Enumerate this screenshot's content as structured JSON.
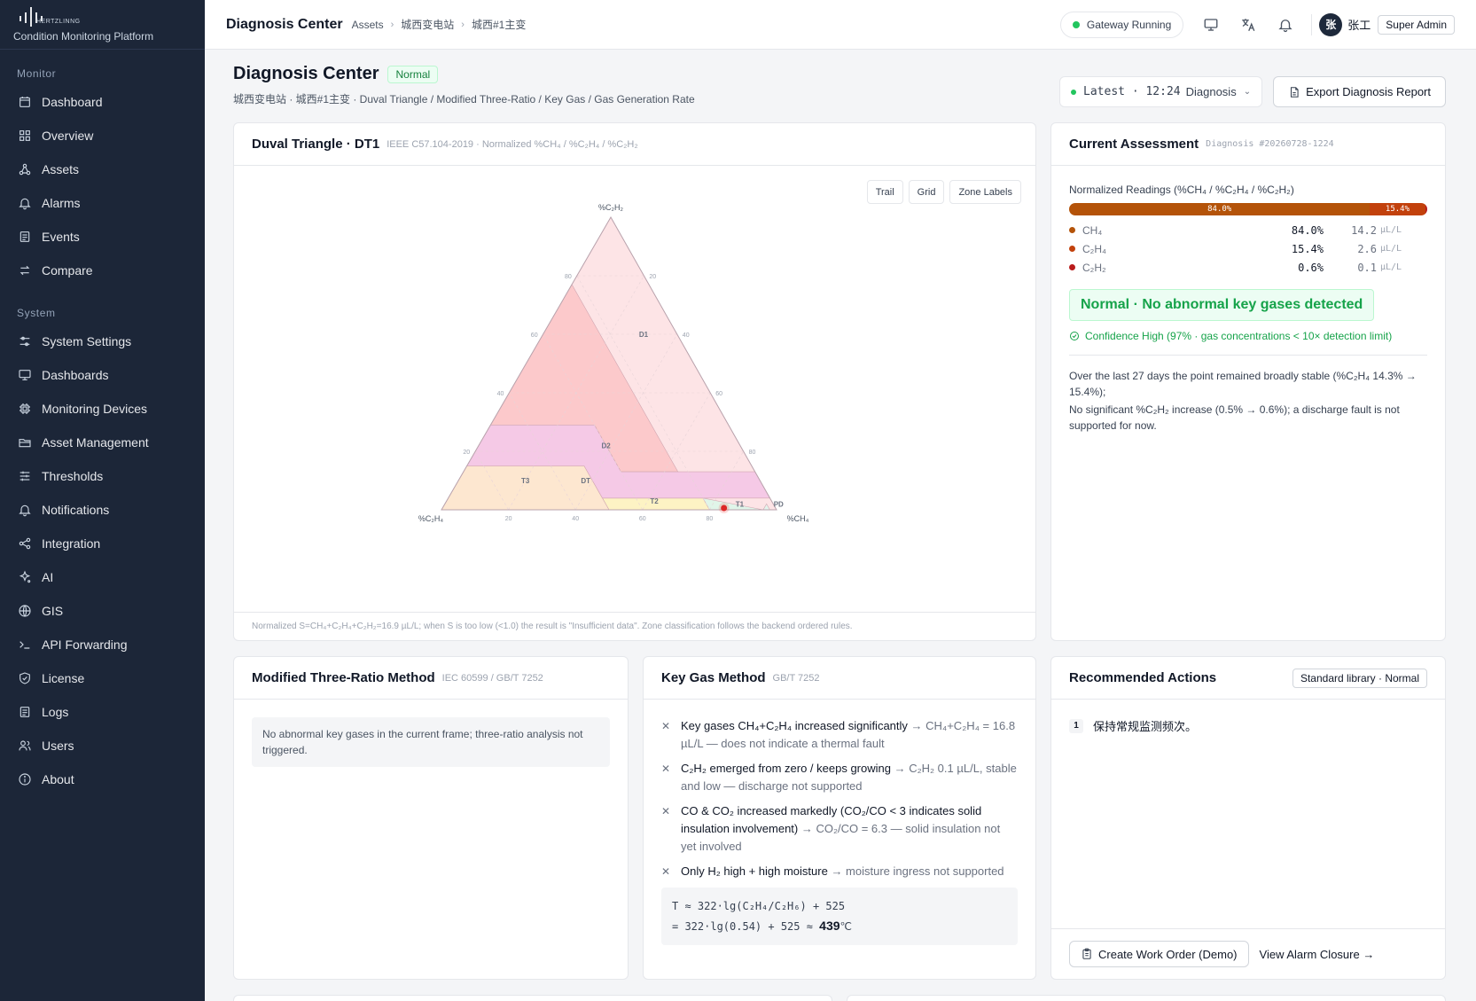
{
  "brand": {
    "logo_text": "HERTZLINNG",
    "subtitle": "Condition Monitoring Platform"
  },
  "sidebar": {
    "sections": [
      {
        "label": "Monitor",
        "items": [
          {
            "label": "Dashboard",
            "icon": "calendar-icon"
          },
          {
            "label": "Overview",
            "icon": "grid-icon"
          },
          {
            "label": "Assets",
            "icon": "nodes-icon"
          },
          {
            "label": "Alarms",
            "icon": "bell-icon"
          },
          {
            "label": "Events",
            "icon": "list-icon"
          },
          {
            "label": "Compare",
            "icon": "swap-icon"
          }
        ]
      },
      {
        "label": "System",
        "items": [
          {
            "label": "System Settings",
            "icon": "sliders-icon"
          },
          {
            "label": "Dashboards",
            "icon": "monitor-icon"
          },
          {
            "label": "Monitoring Devices",
            "icon": "chip-icon"
          },
          {
            "label": "Asset Management",
            "icon": "folder-icon"
          },
          {
            "label": "Thresholds",
            "icon": "tune-icon"
          },
          {
            "label": "Notifications",
            "icon": "bell-icon"
          },
          {
            "label": "Integration",
            "icon": "link-icon"
          },
          {
            "label": "AI",
            "icon": "sparkle-icon"
          },
          {
            "label": "GIS",
            "icon": "globe-icon"
          },
          {
            "label": "API Forwarding",
            "icon": "terminal-icon"
          },
          {
            "label": "License",
            "icon": "shield-icon"
          },
          {
            "label": "Logs",
            "icon": "list-icon"
          },
          {
            "label": "Users",
            "icon": "users-icon"
          },
          {
            "label": "About",
            "icon": "info-icon"
          }
        ]
      }
    ]
  },
  "topbar": {
    "title": "Diagnosis Center",
    "breadcrumb": [
      "Assets",
      "城西变电站",
      "城西#1主变"
    ],
    "gateway_status": "Gateway Running",
    "avatar_initial": "张",
    "username": "张工",
    "role": "Super Admin"
  },
  "page": {
    "title": "Diagnosis Center",
    "status_badge": "Normal",
    "subtitle": "城西变电站 · 城西#1主变 · Duval Triangle / Modified Three-Ratio / Key Gas / Gas Generation Rate",
    "select_time": "Latest · 12:24",
    "select_label": "Diagnosis",
    "export_label": "Export Diagnosis Report"
  },
  "duval": {
    "title": "Duval Triangle · DT1",
    "meta": "IEEE C57.104-2019 · Normalized %CH₄ / %C₂H₄ / %C₂H₂",
    "toolbar": [
      "Trail",
      "Grid",
      "Zone Labels"
    ],
    "vertex_labels": {
      "top": "%C₂H₂",
      "left": "%C₂H₄",
      "right": "%CH₄"
    },
    "zones": [
      "D1",
      "D2",
      "DT",
      "T3",
      "T2",
      "T1",
      "PD"
    ],
    "footer": "Normalized S=CH₄+C₂H₄+C₂H₂=16.9 µL/L; when S is too low (<1.0) the result is \"Insufficient data\". Zone classification follows the backend ordered rules."
  },
  "chart_data": {
    "type": "scatter",
    "title": "Duval Triangle · DT1",
    "axes": [
      "%CH₄",
      "%C₂H₄",
      "%C₂H₂"
    ],
    "ticks": [
      20,
      40,
      60,
      80
    ],
    "points": [
      {
        "ch4": 84.0,
        "c2h4": 15.4,
        "c2h2": 0.6
      }
    ],
    "zones": [
      "D1",
      "D2",
      "DT",
      "T3",
      "T2",
      "T1",
      "PD"
    ]
  },
  "assessment": {
    "title": "Current Assessment",
    "meta": "Diagnosis #20260728-1224",
    "readings_label": "Normalized Readings (%CH₄ / %C₂H₄ / %C₂H₂)",
    "bar": [
      {
        "label": "84.0%",
        "fraction": 0.84,
        "color": "#b45309"
      },
      {
        "label": "15.4%",
        "fraction": 0.154,
        "color": "#c2410c"
      },
      {
        "label": "",
        "fraction": 0.006,
        "color": "#b91c1c"
      }
    ],
    "gases": [
      {
        "name": "CH₄",
        "pct": "84.0%",
        "value": "14.2",
        "unit": "µL/L",
        "color": "#b45309"
      },
      {
        "name": "C₂H₄",
        "pct": "15.4%",
        "value": "2.6",
        "unit": "µL/L",
        "color": "#c2410c"
      },
      {
        "name": "C₂H₂",
        "pct": "0.6%",
        "value": "0.1",
        "unit": "µL/L",
        "color": "#b91c1c"
      }
    ],
    "result": "Normal · No abnormal key gases detected",
    "confidence": "Confidence High (97% · gas concentrations < 10× detection limit)",
    "narrative": [
      "Over the last 27 days the point remained broadly stable (%C₂H₄ 14.3% → 15.4%);",
      "No significant %C₂H₂ increase (0.5% → 0.6%); a discharge fault is not supported for now."
    ]
  },
  "ratio": {
    "title": "Modified Three-Ratio Method",
    "meta": "IEC 60599 / GB/T 7252",
    "note": "No abnormal key gases in the current frame; three-ratio analysis not triggered."
  },
  "keygas": {
    "title": "Key Gas Method",
    "meta": "GB/T 7252",
    "items": [
      {
        "cond": "Key gases CH₄+C₂H₄ increased significantly",
        "res": " → CH₄+C₂H₄ = 16.8 µL/L — does not indicate a thermal fault"
      },
      {
        "cond": "C₂H₂ emerged from zero / keeps growing",
        "res": " → C₂H₂ 0.1 µL/L, stable and low — discharge not supported"
      },
      {
        "cond": "CO & CO₂ increased markedly (CO₂/CO < 3 indicates solid insulation involvement)",
        "res": " → CO₂/CO = 6.3 — solid insulation not yet involved"
      },
      {
        "cond": "Only H₂ high + high moisture",
        "res": " → moisture ingress not supported"
      }
    ],
    "formula_line1": "T ≈ 322·lg(C₂H₄/C₂H₆) + 525",
    "formula_line2": "= 322·lg(0.54) + 525 ≈ ",
    "formula_result": "439",
    "formula_unit": "℃"
  },
  "actions": {
    "title": "Recommended Actions",
    "badge": "Standard library · Normal",
    "items": [
      {
        "num": "1",
        "text": "保持常规监测频次。"
      }
    ],
    "work_order": "Create Work Order (Demo)",
    "alarm_link": "View Alarm Closure →"
  }
}
